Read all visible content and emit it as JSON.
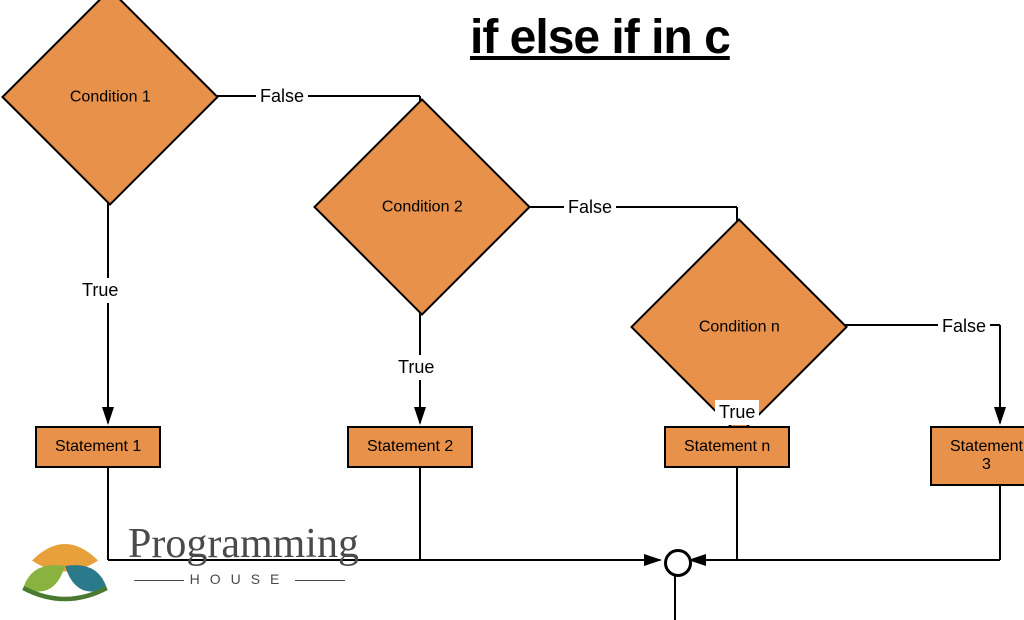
{
  "title": "if else if in c",
  "conditions": [
    "Condition 1",
    "Condition 2",
    "Condition n"
  ],
  "statements": [
    "Statement 1",
    "Statement 2",
    "Statement n",
    "Statement 3"
  ],
  "labels": {
    "true": "True",
    "false": "False"
  },
  "colors": {
    "shape_fill": "#e8914b",
    "shape_stroke": "#000000"
  },
  "brand": {
    "name": "Programming",
    "sub": "HOUSE"
  }
}
